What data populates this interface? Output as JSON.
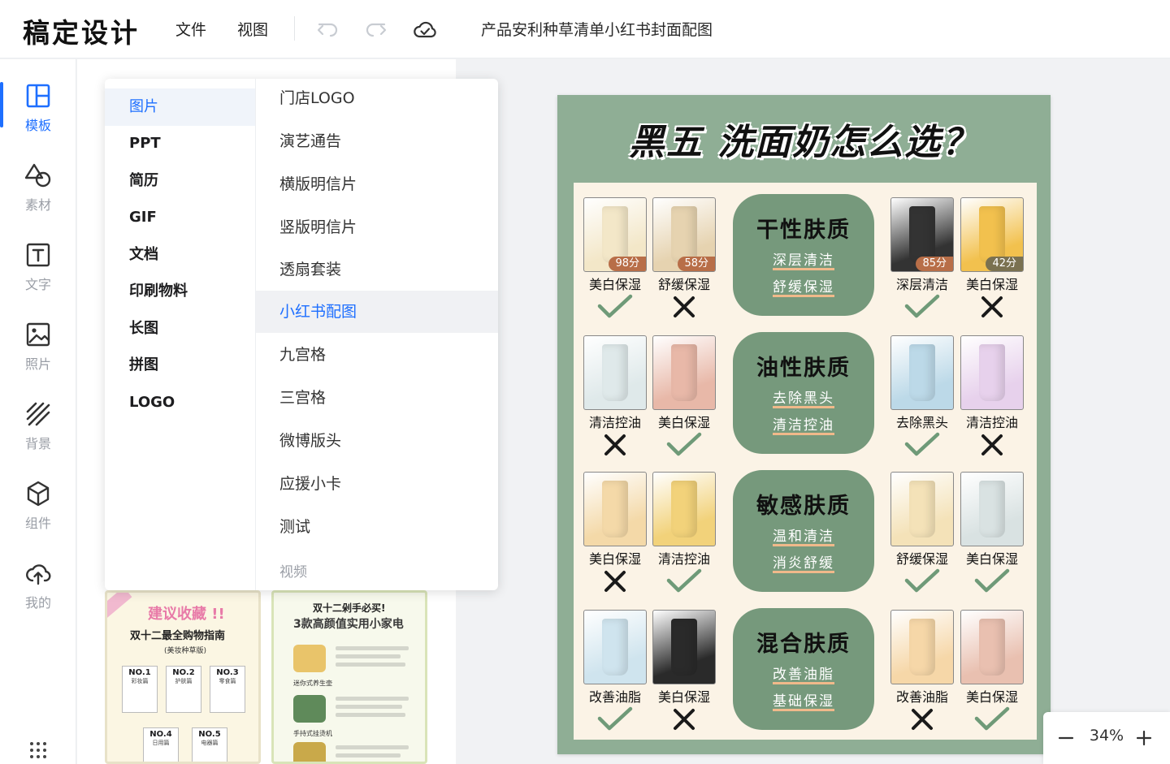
{
  "app": {
    "logo": "稿定设计",
    "menu": [
      "文件",
      "视图"
    ],
    "doc_title": "产品安利种草清单小红书封面配图"
  },
  "rail": [
    {
      "label": "模板",
      "icon": "template-icon",
      "active": true
    },
    {
      "label": "素材",
      "icon": "shapes-icon"
    },
    {
      "label": "文字",
      "icon": "text-icon"
    },
    {
      "label": "照片",
      "icon": "image-icon"
    },
    {
      "label": "背景",
      "icon": "background-icon"
    },
    {
      "label": "组件",
      "icon": "cube-icon"
    },
    {
      "label": "我的",
      "icon": "cloud-upload-icon"
    }
  ],
  "dropdown": {
    "categories": [
      "图片",
      "PPT",
      "简历",
      "GIF",
      "文档",
      "印刷物料",
      "长图",
      "拼图",
      "LOGO"
    ],
    "subcategories": [
      "门店LOGO",
      "演艺通告",
      "横版明信片",
      "竖版明信片",
      "透扇套装",
      "小红书配图",
      "九宫格",
      "三宫格",
      "微博版头",
      "应援小卡",
      "测试",
      "视频"
    ],
    "active_category": "图片",
    "active_sub": "小红书配图"
  },
  "thumbs": {
    "t1": {
      "title": "建议收藏 !!",
      "subtitle": "双十二最全购物指南",
      "sub2": "(美妆种草版)",
      "items": [
        {
          "no": "NO.1",
          "cat": "彩妆篇"
        },
        {
          "no": "NO.2",
          "cat": "护肤篇"
        },
        {
          "no": "NO.3",
          "cat": "零食篇"
        },
        {
          "no": "NO.4",
          "cat": "日用篇"
        },
        {
          "no": "NO.5",
          "cat": "电器篇"
        }
      ]
    },
    "t2": {
      "head": "双十二剁手必买!",
      "title": "3款高颜值实用小家电",
      "labels": [
        "迷你式养生壶",
        "手持式挂烫机"
      ]
    }
  },
  "poster": {
    "title": "黑五 洗面奶怎么选？",
    "skins": [
      {
        "title": "干性肤质",
        "lines": [
          "深层清洁",
          "舒缓保湿"
        ]
      },
      {
        "title": "油性肤质",
        "lines": [
          "去除黑头",
          "清洁控油"
        ]
      },
      {
        "title": "敏感肤质",
        "lines": [
          "温和清洁",
          "消炎舒缓"
        ]
      },
      {
        "title": "混合肤质",
        "lines": [
          "改善油脂",
          "基础保湿"
        ]
      }
    ],
    "rows": [
      {
        "left": [
          {
            "name": "美白保湿",
            "score": "98分",
            "ok": true,
            "tone": "#f3e7c8"
          },
          {
            "name": "舒缓保湿",
            "score": "58分",
            "ok": false,
            "tone": "#e6d3b0"
          }
        ],
        "right": [
          {
            "name": "深层清洁",
            "score": "85分",
            "ok": true,
            "tone": "#333333"
          },
          {
            "name": "美白保湿",
            "score": "42分",
            "ok": false,
            "tone": "#f2c14e"
          }
        ]
      },
      {
        "left": [
          {
            "name": "清洁控油",
            "ok": false,
            "tone": "#dfe9ea"
          },
          {
            "name": "美白保湿",
            "ok": true,
            "tone": "#e8b8a8"
          }
        ],
        "right": [
          {
            "name": "去除黑头",
            "ok": true,
            "tone": "#bcd9e8"
          },
          {
            "name": "清洁控油",
            "ok": false,
            "tone": "#e7d1ec"
          }
        ]
      },
      {
        "left": [
          {
            "name": "美白保湿",
            "ok": false,
            "tone": "#f4d9a8"
          },
          {
            "name": "清洁控油",
            "ok": true,
            "tone": "#f2d27a"
          }
        ],
        "right": [
          {
            "name": "舒缓保湿",
            "ok": true,
            "tone": "#f4e2b8"
          },
          {
            "name": "美白保湿",
            "ok": true,
            "tone": "#d9e2e2"
          }
        ]
      },
      {
        "left": [
          {
            "name": "改善油脂",
            "ok": true,
            "tone": "#cfe4ee"
          },
          {
            "name": "美白保湿",
            "ok": false,
            "tone": "#2a2a2a"
          }
        ],
        "right": [
          {
            "name": "改善油脂",
            "ok": false,
            "tone": "#f6d7a8"
          },
          {
            "name": "美白保湿",
            "ok": true,
            "tone": "#e9c0b0"
          }
        ]
      }
    ]
  },
  "zoom": {
    "value": "34%"
  },
  "colors": {
    "accent": "#1e6fff",
    "poster_bg": "#8fae95",
    "card": "#76997c",
    "check": "#6f9a78"
  }
}
